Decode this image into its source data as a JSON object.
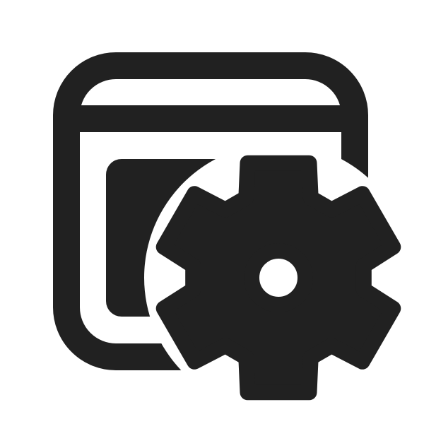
{
  "icon": {
    "name": "app-settings-icon",
    "colors": {
      "glyph": "#212121",
      "background": "#ffffff"
    }
  }
}
